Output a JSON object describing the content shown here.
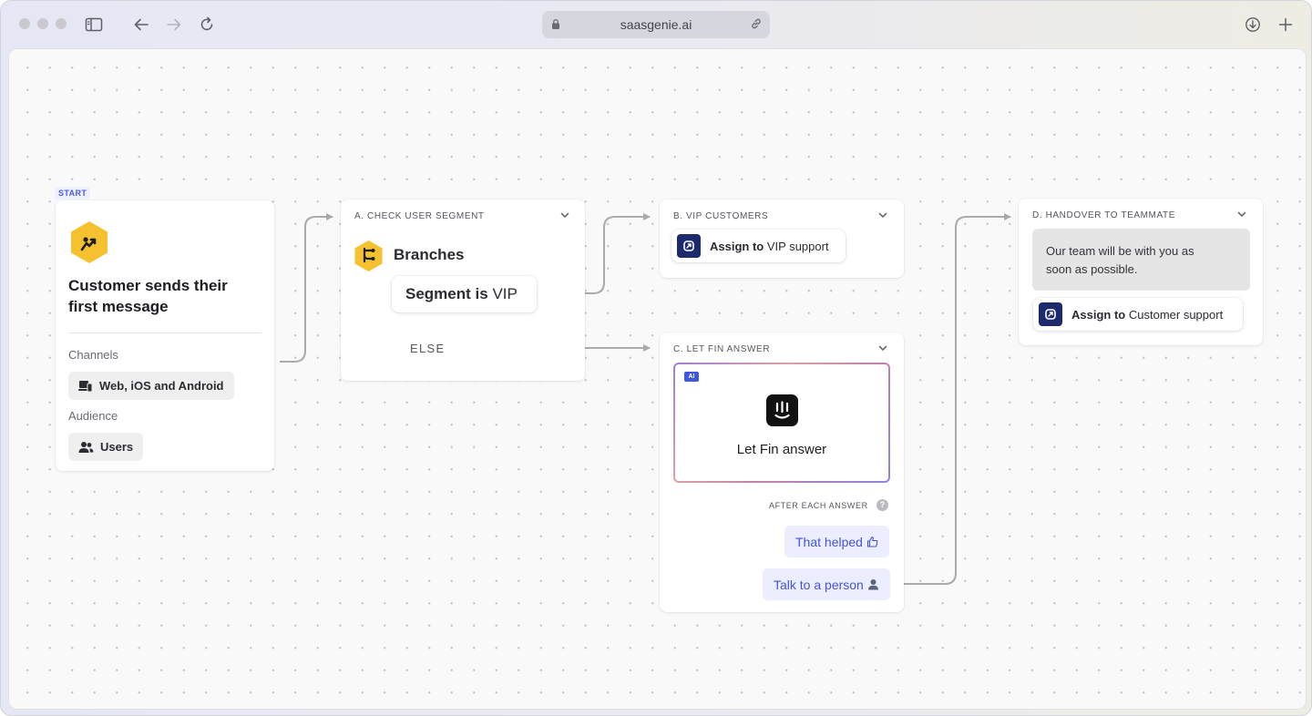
{
  "browser": {
    "url": "saasgenie.ai"
  },
  "start": {
    "badge": "START",
    "title_line1": "Customer sends their",
    "title_line2": "first message",
    "channels_label": "Channels",
    "channels_value": "Web, iOS and Android",
    "audience_label": "Audience",
    "audience_value": "Users"
  },
  "step_a": {
    "title": "A. CHECK USER SEGMENT",
    "branches_label": "Branches",
    "segment_bold": "Segment is",
    "segment_value": "VIP",
    "else_label": "ELSE"
  },
  "step_b": {
    "title": "B. VIP CUSTOMERS",
    "assign_bold": "Assign to",
    "assign_value": "VIP support"
  },
  "step_c": {
    "title": "C. LET FIN ANSWER",
    "ai_badge": "AI",
    "fin_label": "Let Fin answer",
    "after_label": "AFTER EACH ANSWER",
    "help_glyph": "?",
    "reply_1": "That helped",
    "reply_2": "Talk to a person"
  },
  "step_d": {
    "title": "D. HANDOVER TO TEAMMATE",
    "message_line1": "Our team will be with you as",
    "message_line2": "soon as possible.",
    "assign_bold": "Assign to",
    "assign_value": "Customer support"
  },
  "colors": {
    "accent": "#4454d6",
    "hex_yellow": "#f5c12e",
    "assign_navy": "#1d2a6b",
    "connector": "#a9a9ae"
  }
}
